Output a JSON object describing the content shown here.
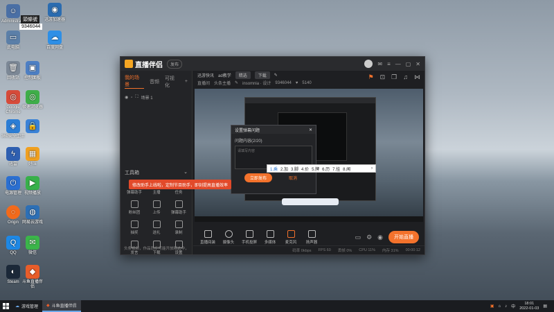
{
  "desktop": {
    "icons": [
      {
        "label": "Administrator",
        "icon": "user-icon",
        "color": "#4a6fa5"
      },
      {
        "label": "迅游加速器",
        "icon": "app-icon",
        "color": "#2b6cb0"
      },
      {
        "label": "此电脑",
        "icon": "computer-icon",
        "color": "#5b7fa8"
      },
      {
        "label": "百度网盘",
        "icon": "cloud-icon",
        "color": "#2e8fe6"
      },
      {
        "label": "回收站",
        "icon": "trash-icon",
        "color": "#7c8896"
      },
      {
        "label": "控制面板",
        "icon": "control-icon",
        "color": "#4d7fc4"
      },
      {
        "label": "Google Chrome",
        "icon": "chrome-icon",
        "color": "#d64b3a"
      },
      {
        "label": "极速浏览器",
        "icon": "browser-icon",
        "color": "#3fae49"
      },
      {
        "label": "360安全卫士",
        "icon": "shield-icon",
        "color": "#2b7dd5"
      },
      {
        "label": "",
        "icon": "lock-icon",
        "color": "#3a82d6"
      },
      {
        "label": "迅雷",
        "icon": "thunder-icon",
        "color": "#2e5fb0"
      },
      {
        "label": "好压",
        "icon": "zip-icon",
        "color": "#f0a020"
      },
      {
        "label": "电源管理",
        "icon": "power-icon",
        "color": "#2a6fd1"
      },
      {
        "label": "视频播放",
        "icon": "play-icon",
        "color": "#37b04a"
      },
      {
        "label": "Origin",
        "icon": "origin-icon",
        "color": "#f26a1b"
      },
      {
        "label": "网易云游戏",
        "icon": "game-icon",
        "color": "#2d6fb5"
      },
      {
        "label": "QQ",
        "icon": "qq-icon",
        "color": "#1e88e5"
      },
      {
        "label": "微信",
        "icon": "wechat-icon",
        "color": "#3bb54a"
      },
      {
        "label": "Steam",
        "icon": "steam-icon",
        "color": "#1b2838"
      },
      {
        "label": "斗鱼直播伴侣",
        "icon": "douyu-icon",
        "color": "#e85d2a"
      }
    ],
    "overlay_text": "9346044",
    "overlay_badge": "頭條號"
  },
  "app": {
    "title": "直播伴侣",
    "version": "发布",
    "left_tabs": [
      "我的场景",
      "音频",
      "可视化"
    ],
    "scene_label": "场景 1",
    "tools_header": "工具箱",
    "tools": [
      {
        "label": "弹幕助手"
      },
      {
        "label": "主播"
      },
      {
        "label": "任务"
      },
      {
        "label": "粉丝团"
      },
      {
        "label": "上传"
      },
      {
        "label": "弹幕助手"
      },
      {
        "label": "抽奖"
      },
      {
        "label": "送礼"
      },
      {
        "label": "录制"
      },
      {
        "label": "发言"
      },
      {
        "label": "下载"
      },
      {
        "label": "设置"
      }
    ],
    "banner_text": "修改助手上线啦，定制节目助手，即刻提高直播效率",
    "left_footer": "头条视频，作品同步可能开放精选中，",
    "info_line1_title": "迅游快讯",
    "info_line1_ad": "ad教学",
    "info_chip1": "精选",
    "info_chip2": "下载",
    "info_line2_room": "直播间",
    "info_line2_live": "头条主播",
    "info_line2_name": "insomnia · 设计",
    "info_line2_id": "9346044",
    "info_line2_fans": "5140",
    "dialog": {
      "title": "设置弹幕问题",
      "subtitle": "问题内容(2/20)",
      "box_hint": "请填写内容",
      "ok": "立即发布",
      "cancel": "取消"
    },
    "word_popup": [
      "1.乘",
      "2.加",
      "3.脚",
      "4.价",
      "5.牌",
      "6.历",
      "7.挂",
      "8.闻"
    ],
    "bottom_controls": [
      {
        "label": "直播间装",
        "icon": "display-icon"
      },
      {
        "label": "摄像头",
        "icon": "camera-icon"
      },
      {
        "label": "手机投屏",
        "icon": "phone-icon"
      },
      {
        "label": "多媒体",
        "icon": "media-icon"
      },
      {
        "label": "麦克风",
        "icon": "mic-icon"
      },
      {
        "label": "扬声器",
        "icon": "speaker-icon"
      }
    ],
    "start_button": "开始直播",
    "status": {
      "bitrate": "码率 0kbps",
      "fps": "FPS 60",
      "drop": "丢帧 0%",
      "cpu": "CPU 11%",
      "mem": "内存 31%",
      "time": "00:00:12"
    }
  },
  "taskbar": {
    "item1": "游戏管理",
    "item2": "斗鱼直播伴侣",
    "time": "18:01",
    "date": "2022-01-03"
  }
}
